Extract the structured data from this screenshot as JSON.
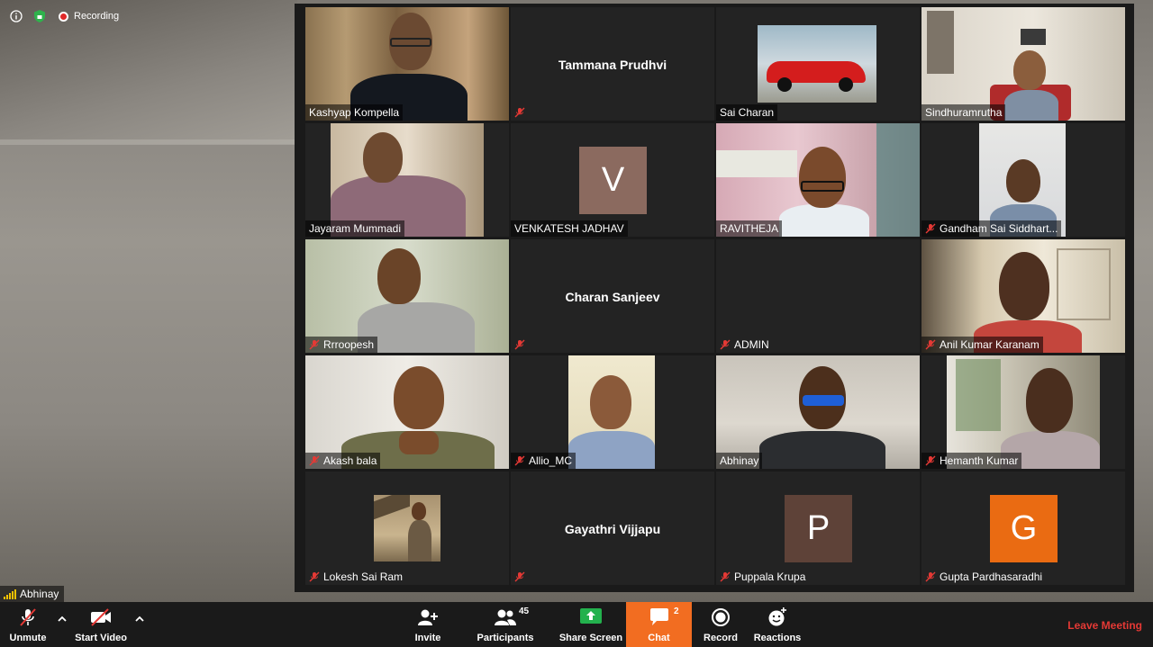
{
  "status": {
    "recording_label": "Recording"
  },
  "gallery": {
    "tiles": [
      {
        "name": "Kashyap Kompella",
        "muted": false,
        "type": "video"
      },
      {
        "name": "Tammana Prudhvi",
        "muted": true,
        "type": "name"
      },
      {
        "name": "Sai Charan",
        "muted": false,
        "type": "video"
      },
      {
        "name": "Sindhuramrutha",
        "muted": false,
        "type": "video"
      },
      {
        "name": "Jayaram Mummadi",
        "muted": false,
        "type": "video"
      },
      {
        "name": "VENKATESH JADHAV",
        "muted": false,
        "type": "avatar",
        "initial": "V",
        "color": "#8b6a5f"
      },
      {
        "name": "RAVITHEJA",
        "muted": false,
        "type": "video"
      },
      {
        "name": "Gandham Sai Siddhart...",
        "muted": true,
        "type": "video"
      },
      {
        "name": "Rrroopesh",
        "muted": true,
        "type": "video"
      },
      {
        "name": "Charan Sanjeev",
        "muted": true,
        "type": "name"
      },
      {
        "name": "ADMIN",
        "muted": true,
        "type": "blank"
      },
      {
        "name": "Anil Kumar Karanam",
        "muted": true,
        "type": "video"
      },
      {
        "name": "Akash bala",
        "muted": true,
        "type": "video"
      },
      {
        "name": "Allio_MC",
        "muted": true,
        "type": "video"
      },
      {
        "name": "Abhinay",
        "muted": false,
        "type": "video",
        "active": true
      },
      {
        "name": "Hemanth Kumar",
        "muted": true,
        "type": "video"
      },
      {
        "name": "Lokesh Sai Ram",
        "muted": true,
        "type": "video"
      },
      {
        "name": "Gayathri Vijjapu",
        "muted": true,
        "type": "name"
      },
      {
        "name": "Puppala Krupa",
        "muted": true,
        "type": "avatar",
        "initial": "P",
        "color": "#5e4238"
      },
      {
        "name": "Gupta Pardhasaradhi",
        "muted": true,
        "type": "avatar",
        "initial": "G",
        "color": "#ea6b12"
      }
    ]
  },
  "self_view": {
    "name": "Abhinay"
  },
  "toolbar": {
    "unmute": "Unmute",
    "start_video": "Start Video",
    "invite": "Invite",
    "participants": "Participants",
    "participants_count": "45",
    "share_screen": "Share Screen",
    "chat": "Chat",
    "chat_count": "2",
    "record": "Record",
    "reactions": "Reactions",
    "leave": "Leave Meeting"
  },
  "colors": {
    "accent_orange": "#f26d21",
    "active_speaker": "#c8e05a",
    "leave_red": "#e53935",
    "share_green": "#23b14d"
  }
}
